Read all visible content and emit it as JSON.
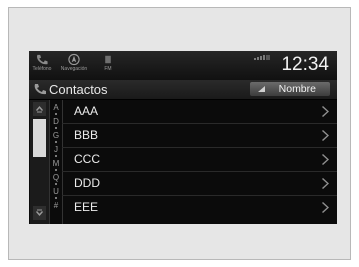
{
  "statusbar": {
    "items": [
      {
        "label": "Teléfono",
        "icon": "phone-icon"
      },
      {
        "label": "Navegación",
        "icon": "navigation-icon"
      },
      {
        "label": "FM",
        "icon": "fm-radio-icon"
      }
    ],
    "clock": "12:34"
  },
  "header": {
    "title": "Contactos",
    "sort_label": "Nombre"
  },
  "alphabet_index": [
    "A",
    "D",
    "G",
    "J",
    "M",
    "Q",
    "U",
    "#"
  ],
  "contacts": [
    {
      "name": "AAA"
    },
    {
      "name": "BBB"
    },
    {
      "name": "CCC"
    },
    {
      "name": "DDD"
    },
    {
      "name": "EEE"
    }
  ],
  "colors": {
    "screen_bg": "#0b0b0b",
    "text": "#ececec",
    "accent_button": "#5a5a5a"
  }
}
